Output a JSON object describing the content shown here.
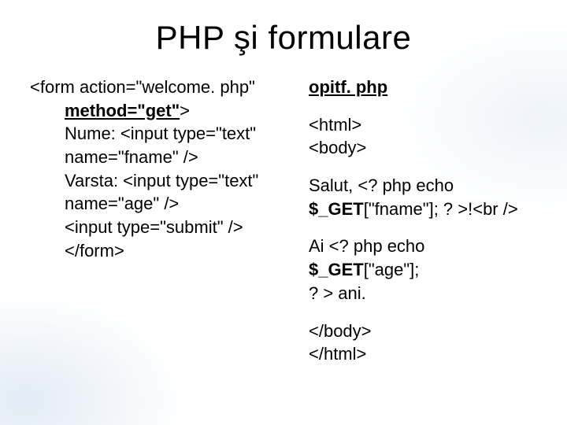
{
  "title": "PHP şi formulare",
  "left": {
    "l1a": "<form action=\"welcome. php\"",
    "l1b_bold_underline": "method=\"get\"",
    "l1b_tail": ">",
    "l2": "Nume: <input type=\"text\"",
    "l3": "name=\"fname\" />",
    "l4": "Varsta: <input type=\"text\"",
    "l5": "name=\"age\" />",
    "l6": "<input type=\"submit\" />",
    "l7": "</form>"
  },
  "right": {
    "heading": "opitf. php",
    "p1a": "<html>",
    "p1b": "<body>",
    "p2a": "Salut, <? php echo",
    "p2b_bold": "$_GET",
    "p2b_tail": "[\"fname\"]; ? >!<br />",
    "p3a": "Ai <? php echo ",
    "p3a_bold": "$_GET",
    "p3a_tail": "[\"age\"];",
    "p3b": "? > ani.",
    "p4a": "</body>",
    "p4b": "</html>"
  }
}
